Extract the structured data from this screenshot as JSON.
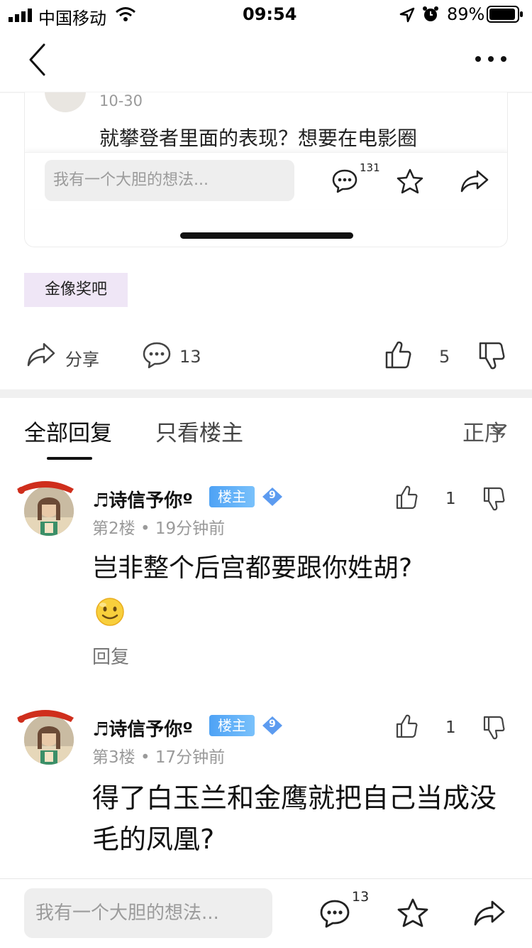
{
  "status_bar": {
    "carrier": "中国移动",
    "time": "09:54",
    "battery": "89%"
  },
  "card": {
    "date": "10-30",
    "snippet": "就攀登者里面的表现？想要在电影圈",
    "input_placeholder": "我有一个大胆的想法...",
    "comment_badge": "131"
  },
  "tag": "金像奖吧",
  "post_actions": {
    "share_label": "分享",
    "comment_count": "13",
    "like_count": "5"
  },
  "tabs": {
    "all": "全部回复",
    "owner": "只看楼主",
    "sort": "正序"
  },
  "replies": [
    {
      "user": "♬诗信予你º",
      "badge": "楼主",
      "level": "9",
      "floor": "第2楼",
      "time": "19分钟前",
      "text": "岂非整个后宫都要跟你姓胡?",
      "like_count": "1",
      "reply_label": "回复"
    },
    {
      "user": "♬诗信予你º",
      "badge": "楼主",
      "level": "9",
      "floor": "第3楼",
      "time": "17分钟前",
      "text": "得了白玉兰和金鹰就把自己当成没毛的凤凰?",
      "like_count": "1"
    }
  ],
  "bottom_bar": {
    "input_placeholder": "我有一个大胆的想法...",
    "comment_badge": "13"
  },
  "icons": [
    "signal-icon",
    "wifi-icon",
    "location-icon",
    "alarm-icon",
    "battery-icon",
    "back-icon",
    "more-icon",
    "comment-icon",
    "star-icon",
    "share-icon",
    "thumbs-up-icon",
    "thumbs-down-icon",
    "chevron-down-icon",
    "smile-emoji-icon"
  ]
}
